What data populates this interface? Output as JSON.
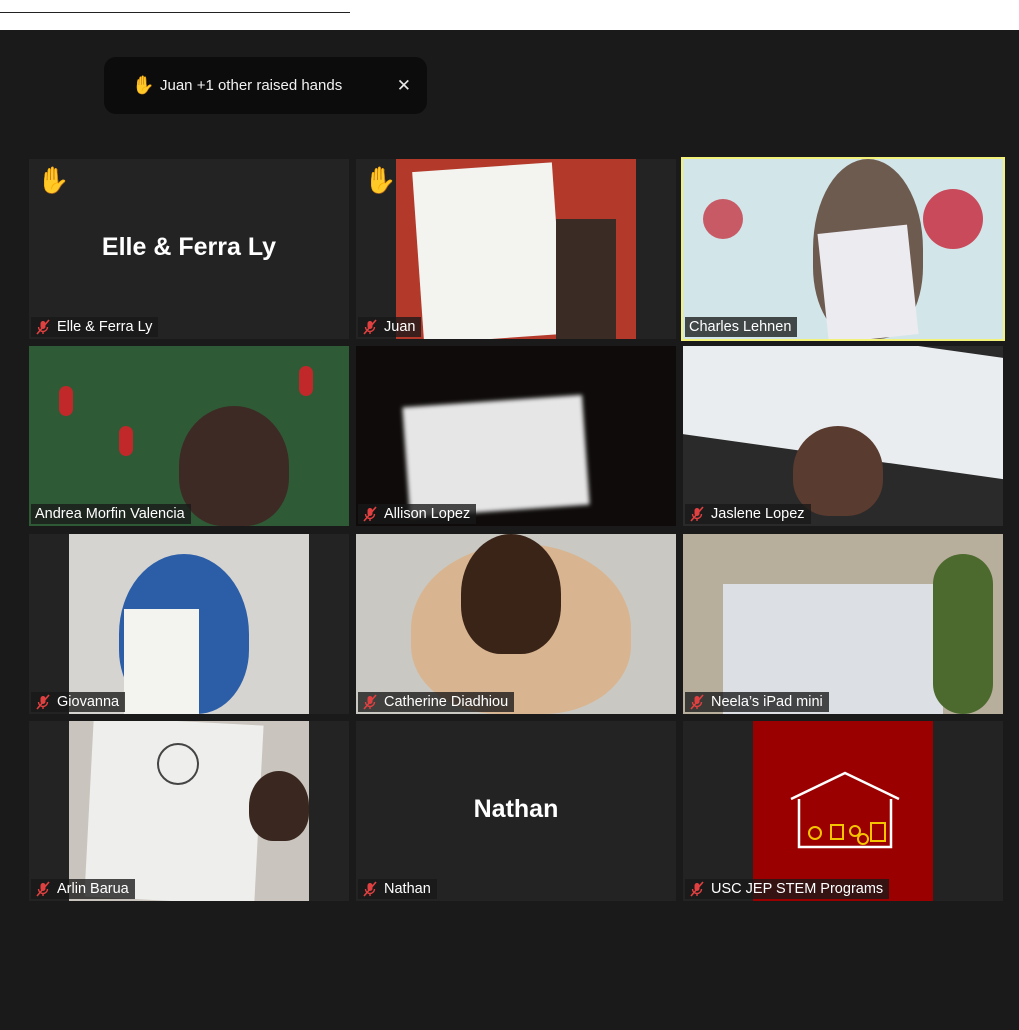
{
  "notification": {
    "text": "Juan +1 other raised hands",
    "close": "✕"
  },
  "participants": [
    {
      "name": "Elle & Ferra Ly",
      "display": "Elle & Ferra Ly",
      "muted": true,
      "hand_raised": true
    },
    {
      "name": "Juan",
      "muted": true,
      "hand_raised": true
    },
    {
      "name": "Charles Lehnen",
      "muted": false,
      "active_speaker": true
    },
    {
      "name": "Andrea Morfin Valencia",
      "muted": false
    },
    {
      "name": "Allison Lopez",
      "muted": true
    },
    {
      "name": "Jaslene Lopez",
      "muted": true
    },
    {
      "name": "Giovanna",
      "muted": true
    },
    {
      "name": "Catherine Diadhiou",
      "muted": true
    },
    {
      "name": "Neela’s iPad mini",
      "muted": true
    },
    {
      "name": "Arlin Barua",
      "muted": true
    },
    {
      "name": "Nathan",
      "display": "Nathan",
      "muted": true
    },
    {
      "name": "USC JEP STEM Programs",
      "muted": true
    }
  ],
  "colors": {
    "hand": "#f5b400",
    "mute": "#e04040",
    "active_border": "#f2f27a",
    "usc_red": "#9a0000"
  }
}
